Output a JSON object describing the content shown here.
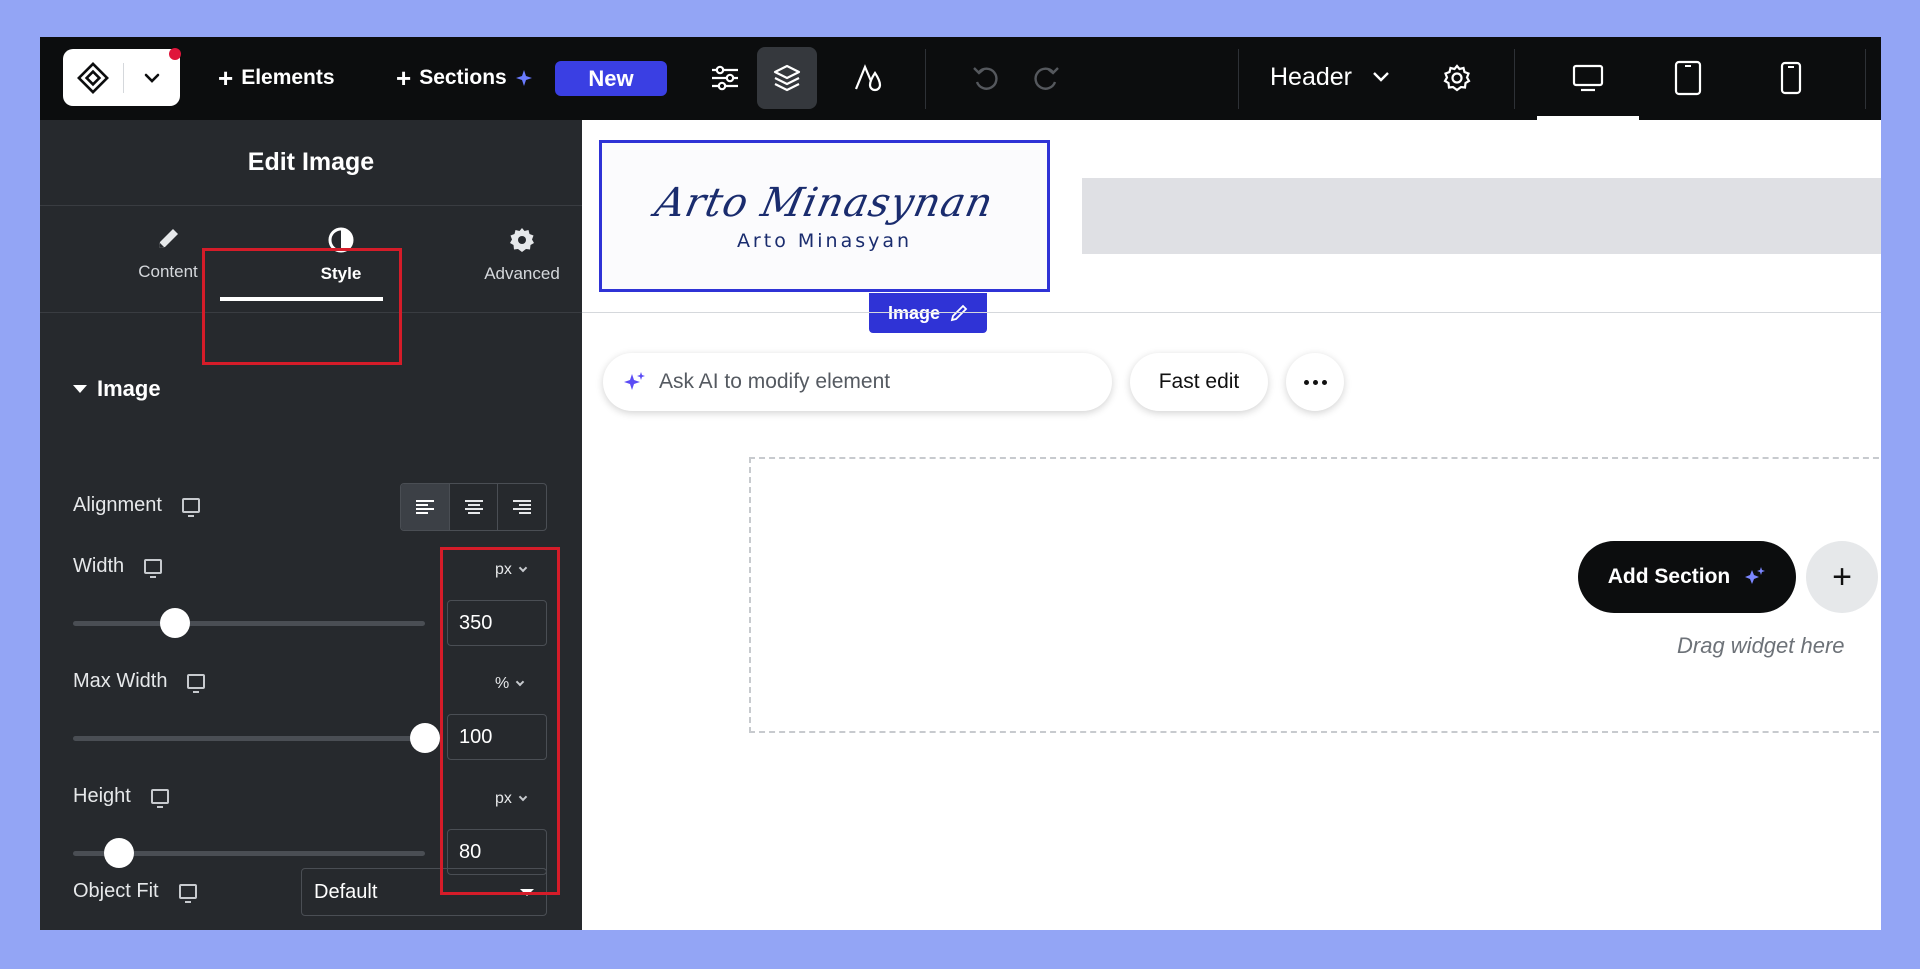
{
  "topbar": {
    "elements_label": "Elements",
    "sections_label": "Sections",
    "new_badge": "New",
    "page_dropdown": "Header"
  },
  "panel": {
    "title": "Edit Image",
    "tabs": [
      {
        "label": "Content",
        "icon": "pencil-icon"
      },
      {
        "label": "Style",
        "icon": "half-circle-icon"
      },
      {
        "label": "Advanced",
        "icon": "gear-icon"
      }
    ],
    "active_tab": "Style",
    "section_title": "Image",
    "alignment": {
      "label": "Alignment",
      "selected": "left"
    },
    "width": {
      "label": "Width",
      "unit": "px",
      "value": "350",
      "slider_fraction": 0.29
    },
    "max_width": {
      "label": "Max Width",
      "unit": "%",
      "value": "100",
      "slider_fraction": 1.0
    },
    "height": {
      "label": "Height",
      "unit": "px",
      "value": "80",
      "slider_fraction": 0.13
    },
    "object_fit": {
      "label": "Object Fit",
      "value": "Default"
    }
  },
  "canvas": {
    "logo_script": "Arto Minasynan",
    "logo_name": "Arto Minasyan",
    "image_tag": "Image",
    "ai_placeholder": "Ask AI to modify element",
    "fast_edit": "Fast edit",
    "add_section": "Add Section",
    "drag_hint": "Drag widget here"
  },
  "colors": {
    "accent": "#2f33d6",
    "new_badge": "#3a3fe3",
    "panel_bg": "#26292d",
    "topbar_bg": "#0c0d0e",
    "highlight": "#d51c29",
    "ai_sparkle": "#5b4cf5"
  }
}
